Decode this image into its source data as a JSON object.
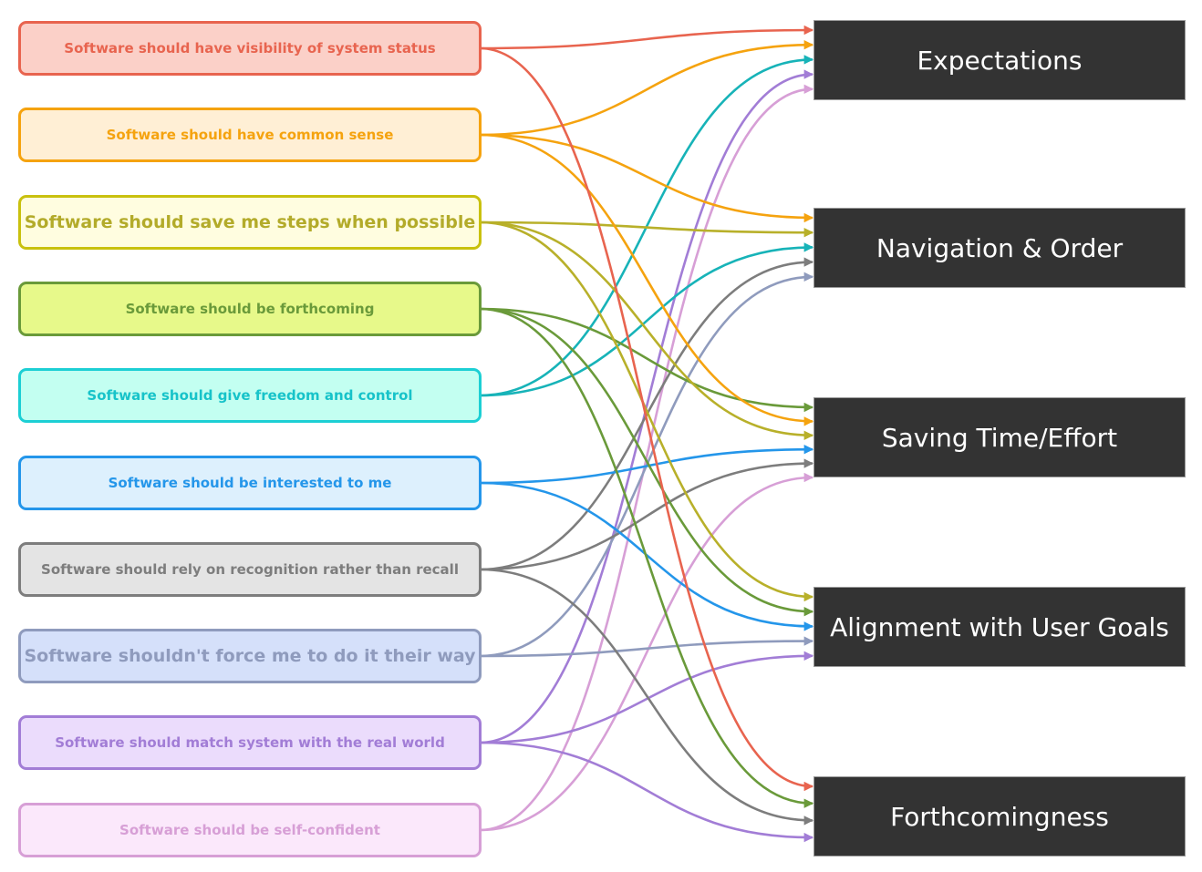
{
  "diagram": {
    "type": "bipartite-mapping",
    "sources": [
      {
        "id": "s0",
        "label": "Software should have visibility of system status",
        "stroke": "#e8644f",
        "fill": "#fbd0c8",
        "text": "#e8644f",
        "large": false
      },
      {
        "id": "s1",
        "label": "Software should have common sense",
        "stroke": "#f5a30f",
        "fill": "#ffefd5",
        "text": "#f5a30f",
        "large": false
      },
      {
        "id": "s2",
        "label": "Software should save me steps when possible",
        "stroke": "#c9c10e",
        "fill": "#fffde0",
        "text": "#b3ab2a",
        "large": true
      },
      {
        "id": "s3",
        "label": "Software should be forthcoming",
        "stroke": "#6a9a3a",
        "fill": "#e7f98a",
        "text": "#6a9a3a",
        "large": false
      },
      {
        "id": "s4",
        "label": "Software should give freedom and control",
        "stroke": "#1ccfd4",
        "fill": "#c3fff1",
        "text": "#17c3c9",
        "large": false
      },
      {
        "id": "s5",
        "label": "Software should be interested to me",
        "stroke": "#2496ea",
        "fill": "#ddf0fd",
        "text": "#2496ea",
        "large": false
      },
      {
        "id": "s6",
        "label": "Software should rely on recognition rather than recall",
        "stroke": "#7d7d7d",
        "fill": "#e4e4e4",
        "text": "#7d7d7d",
        "large": false
      },
      {
        "id": "s7",
        "label": "Software shouldn't force me to do it their way",
        "stroke": "#8f9bbd",
        "fill": "#d5e0fa",
        "text": "#8f9bbd",
        "large": true
      },
      {
        "id": "s8",
        "label": "Software should match system with the real world",
        "stroke": "#a27dd6",
        "fill": "#ebdcfc",
        "text": "#a27dd6",
        "large": false
      },
      {
        "id": "s9",
        "label": "Software should be self-confident",
        "stroke": "#d79fd6",
        "fill": "#fbe8fb",
        "text": "#d79fd6",
        "large": false
      }
    ],
    "targets": [
      {
        "id": "t0",
        "label": "Expectations"
      },
      {
        "id": "t1",
        "label": "Navigation & Order"
      },
      {
        "id": "t2",
        "label": "Saving Time/Effort"
      },
      {
        "id": "t3",
        "label": "Alignment with User Goals"
      },
      {
        "id": "t4",
        "label": "Forthcomingness"
      }
    ],
    "edges": [
      {
        "from": "s0",
        "to": "t0",
        "color": "#e8644f"
      },
      {
        "from": "s1",
        "to": "t0",
        "color": "#f5a30f"
      },
      {
        "from": "s4",
        "to": "t0",
        "color": "#17b3b8"
      },
      {
        "from": "s8",
        "to": "t0",
        "color": "#a27dd6"
      },
      {
        "from": "s9",
        "to": "t0",
        "color": "#d79fd6"
      },
      {
        "from": "s1",
        "to": "t1",
        "color": "#f5a30f"
      },
      {
        "from": "s2",
        "to": "t1",
        "color": "#b8b02a"
      },
      {
        "from": "s4",
        "to": "t1",
        "color": "#17b3b8"
      },
      {
        "from": "s6",
        "to": "t1",
        "color": "#7d7d7d"
      },
      {
        "from": "s7",
        "to": "t1",
        "color": "#8f9bbd"
      },
      {
        "from": "s3",
        "to": "t2",
        "color": "#6a9a3a"
      },
      {
        "from": "s1",
        "to": "t2",
        "color": "#f5a30f"
      },
      {
        "from": "s2",
        "to": "t2",
        "color": "#b8b02a"
      },
      {
        "from": "s5",
        "to": "t2",
        "color": "#2496ea"
      },
      {
        "from": "s6",
        "to": "t2",
        "color": "#7d7d7d"
      },
      {
        "from": "s9",
        "to": "t2",
        "color": "#d79fd6"
      },
      {
        "from": "s2",
        "to": "t3",
        "color": "#b8b02a"
      },
      {
        "from": "s3",
        "to": "t3",
        "color": "#6a9a3a"
      },
      {
        "from": "s5",
        "to": "t3",
        "color": "#2496ea"
      },
      {
        "from": "s7",
        "to": "t3",
        "color": "#8f9bbd"
      },
      {
        "from": "s8",
        "to": "t3",
        "color": "#a27dd6"
      },
      {
        "from": "s0",
        "to": "t4",
        "color": "#e8644f"
      },
      {
        "from": "s3",
        "to": "t4",
        "color": "#6a9a3a"
      },
      {
        "from": "s6",
        "to": "t4",
        "color": "#7d7d7d"
      },
      {
        "from": "s8",
        "to": "t4",
        "color": "#a27dd6"
      }
    ]
  }
}
